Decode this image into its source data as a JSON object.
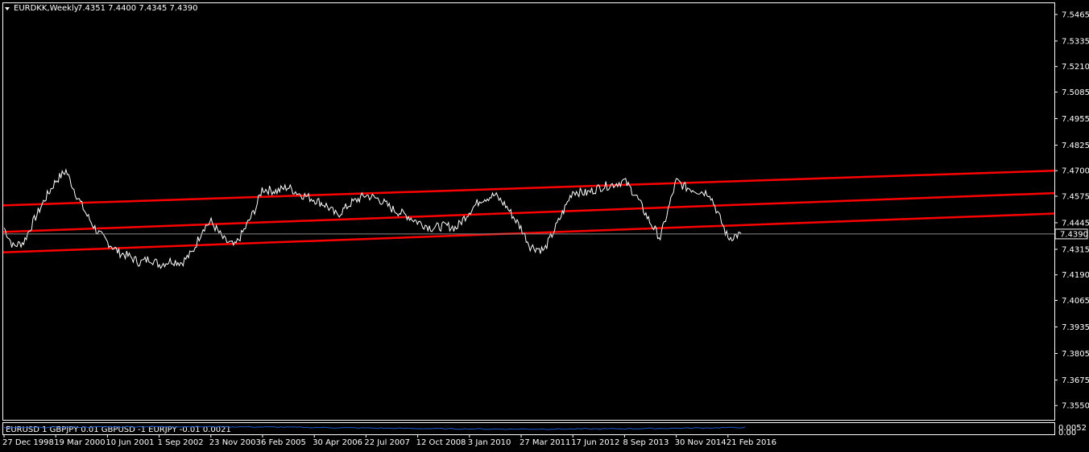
{
  "header": {
    "symbol_label": "EURDKK,Weekly",
    "ohlc": "7.4351 7.4400 7.4345 7.4390"
  },
  "indicator": {
    "label": "EURUSD 1 GBPJPY 0.01 GBPUSD -1 EURJPY -0.01 0.0021",
    "axis_labels": [
      "0.0052",
      "0.00"
    ]
  },
  "colors": {
    "background": "#000000",
    "price_line": "#ffffff",
    "channel": "#ff0000",
    "indicator_line": "#1e5bd6",
    "frame": "#ffffff"
  },
  "chart_data": {
    "type": "line",
    "ylim": [
      7.348,
      7.552
    ],
    "y_ticks": [
      "7.5465",
      "7.5335",
      "7.5210",
      "7.5085",
      "7.4955",
      "7.4825",
      "7.4700",
      "7.4575",
      "7.4445",
      "7.4315",
      "7.4190",
      "7.4065",
      "7.3935",
      "7.3805",
      "7.3675",
      "7.3550"
    ],
    "x_ticks": [
      "27 Dec 1998",
      "19 Mar 2000",
      "10 Jun 2001",
      "1 Sep 2002",
      "23 Nov 2003",
      "6 Feb 2005",
      "30 Apr 2006",
      "22 Jul 2007",
      "12 Oct 2008",
      "3 Jan 2010",
      "27 Mar 2011",
      "17 Jun 2012",
      "8 Sep 2013",
      "30 Nov 2014",
      "21 Feb 2016"
    ],
    "current_price": "7.4390",
    "current_value": 7.439,
    "series": [
      {
        "x": [
          "1998-12-27",
          "1999-03",
          "1999-06",
          "1999-09",
          "1999-12",
          "2000-03-19",
          "2000-06",
          "2000-09",
          "2000-12",
          "2001-03",
          "2001-06-10",
          "2001-09",
          "2001-12",
          "2002-03",
          "2002-06",
          "2002-09-01",
          "2002-12",
          "2003-03",
          "2003-06",
          "2003-09",
          "2003-11-23",
          "2004-03",
          "2004-06",
          "2004-09",
          "2004-12",
          "2005-02-06",
          "2005-06",
          "2005-09",
          "2005-12",
          "2006-04-30",
          "2006-08",
          "2006-11",
          "2007-03",
          "2007-07-22",
          "2007-11",
          "2008-03",
          "2008-07",
          "2008-10-12",
          "2009-02",
          "2009-06",
          "2009-09",
          "2010-01-03",
          "2010-04",
          "2010-08",
          "2010-11",
          "2011-03-27",
          "2011-06",
          "2011-10",
          "2012-02",
          "2012-06-17",
          "2012-10",
          "2013-02",
          "2013-05",
          "2013-09-08",
          "2013-12",
          "2014-04",
          "2014-07",
          "2014-11-30",
          "2015-02",
          "2015-06",
          "2015-09",
          "2016-02-21",
          "2016-06"
        ],
        "values": [
          7.442,
          7.433,
          7.435,
          7.446,
          7.456,
          7.465,
          7.47,
          7.458,
          7.448,
          7.44,
          7.435,
          7.43,
          7.428,
          7.425,
          7.427,
          7.424,
          7.426,
          7.425,
          7.43,
          7.442,
          7.445,
          7.436,
          7.433,
          7.442,
          7.452,
          7.461,
          7.46,
          7.462,
          7.459,
          7.456,
          7.453,
          7.448,
          7.454,
          7.458,
          7.456,
          7.451,
          7.448,
          7.445,
          7.442,
          7.443,
          7.442,
          7.45,
          7.456,
          7.458,
          7.453,
          7.442,
          7.433,
          7.431,
          7.445,
          7.46,
          7.459,
          7.462,
          7.463,
          7.465,
          7.458,
          7.445,
          7.437,
          7.465,
          7.462,
          7.46,
          7.459,
          7.437,
          7.439
        ]
      }
    ],
    "channel_lines": [
      {
        "from": 7.453,
        "to": 7.47
      },
      {
        "from": 7.44,
        "to": 7.459
      },
      {
        "from": 7.43,
        "to": 7.449
      }
    ]
  }
}
